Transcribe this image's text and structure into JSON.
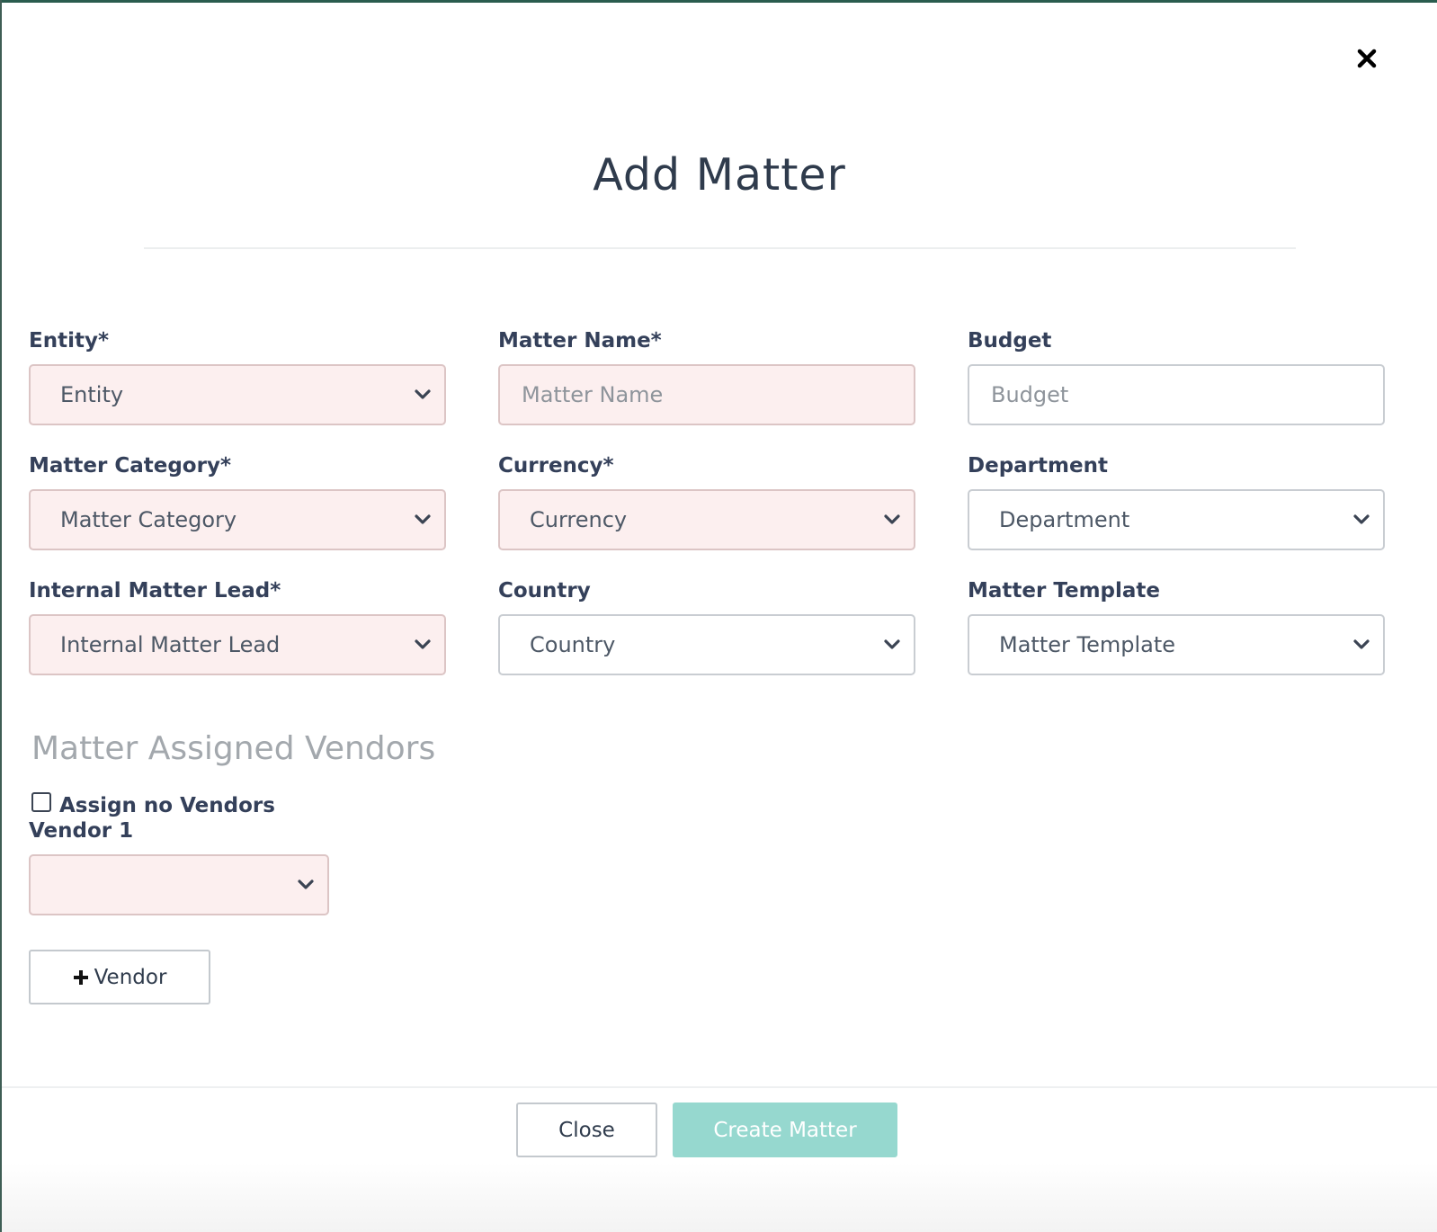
{
  "modal": {
    "title": "Add Matter",
    "close_icon": "close-icon"
  },
  "colors": {
    "required_field_bg": "#fcefef",
    "primary_button": "#96d8cf",
    "text": "#34405a",
    "section_heading": "#a3a8ad"
  },
  "fields": {
    "entity": {
      "label": "Entity*",
      "value": "Entity",
      "type": "select",
      "required": true
    },
    "matter_name": {
      "label": "Matter Name*",
      "placeholder": "Matter Name",
      "type": "input",
      "required": true
    },
    "budget": {
      "label": "Budget",
      "placeholder": "Budget",
      "type": "input",
      "required": false
    },
    "matter_category": {
      "label": "Matter Category*",
      "value": "Matter Category",
      "type": "select",
      "required": true
    },
    "currency": {
      "label": "Currency*",
      "value": "Currency",
      "type": "select",
      "required": true
    },
    "department": {
      "label": "Department",
      "value": "Department",
      "type": "select",
      "required": false
    },
    "internal_matter_lead": {
      "label": "Internal Matter Lead*",
      "value": "Internal Matter Lead",
      "type": "select",
      "required": true
    },
    "country": {
      "label": "Country",
      "value": "Country",
      "type": "select",
      "required": false
    },
    "matter_template": {
      "label": "Matter Template",
      "value": "Matter Template",
      "type": "select",
      "required": false
    }
  },
  "vendors": {
    "heading": "Matter Assigned Vendors",
    "assign_none_label": "Assign no Vendors",
    "assign_none_checked": false,
    "vendor_1_label": "Vendor 1",
    "vendor_1_value": "",
    "add_vendor_label": "Vendor"
  },
  "footer": {
    "close_label": "Close",
    "create_label": "Create Matter"
  }
}
